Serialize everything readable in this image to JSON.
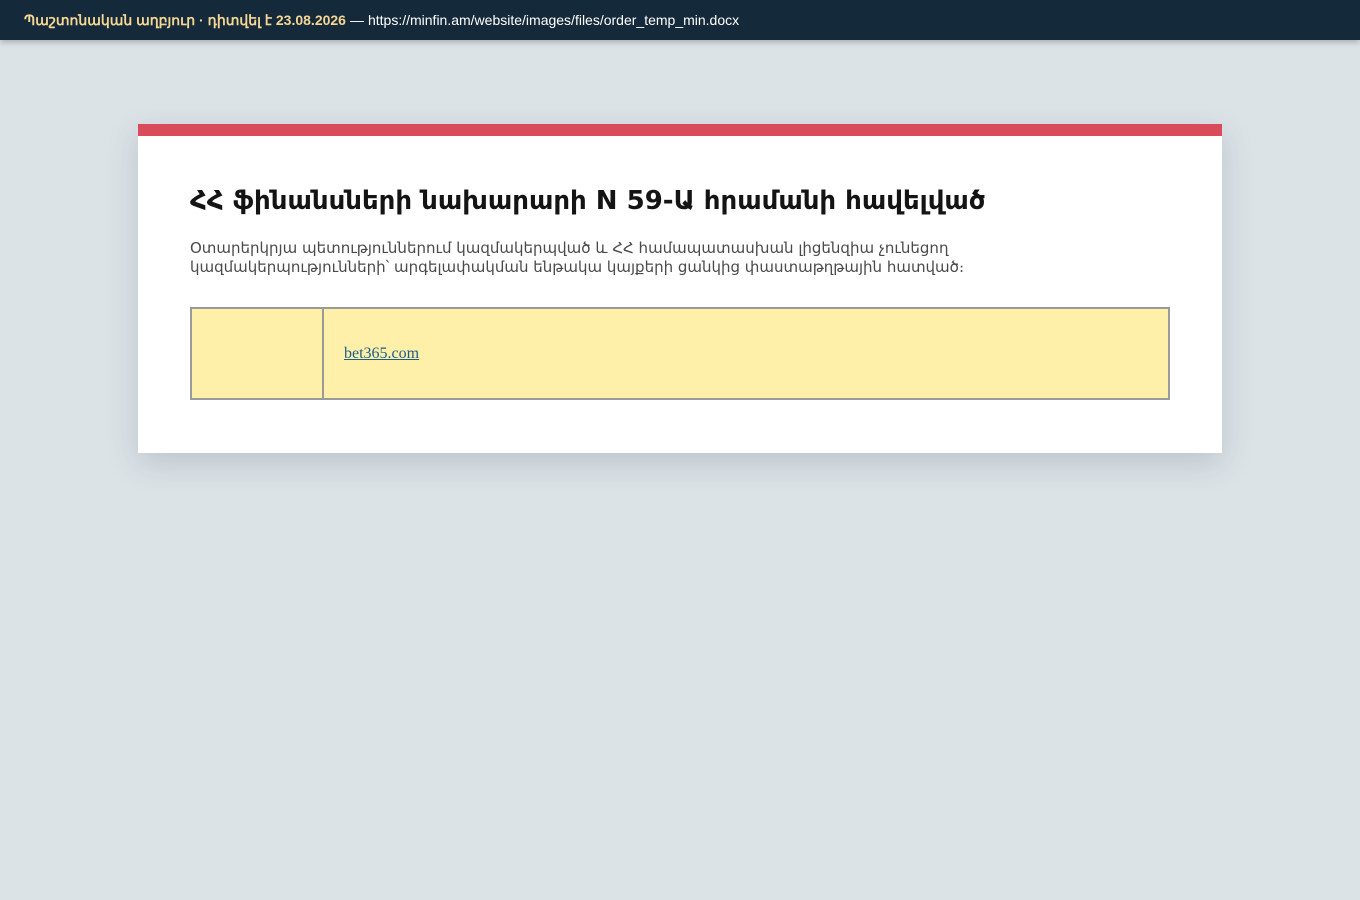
{
  "topbar": {
    "source_label": "Պաշտոնական աղբյուր · դիտվել է 23.08.2026",
    "separator": "—",
    "url": "https://minfin.am/website/images/files/order_temp_min.docx"
  },
  "document": {
    "title": "ՀՀ ֆինանսների նախարարի N 59-Ա հրամանի հավելված",
    "description": "Օտարերկրյա պետություններում կազմակերպված և ՀՀ համապատասխան լիցենզիա չունեցող կազմակերպությունների՝ արգելափակման ենթակա կայքերի ցանկից փաստաթղթային հատված։",
    "table": {
      "rows": [
        {
          "number": "",
          "site": "bet365.com"
        }
      ]
    }
  },
  "colors": {
    "topbar_bg": "#14293a",
    "accent": "#d94a5a",
    "highlight_row": "#fef0a8",
    "link": "#1d5d8c"
  }
}
